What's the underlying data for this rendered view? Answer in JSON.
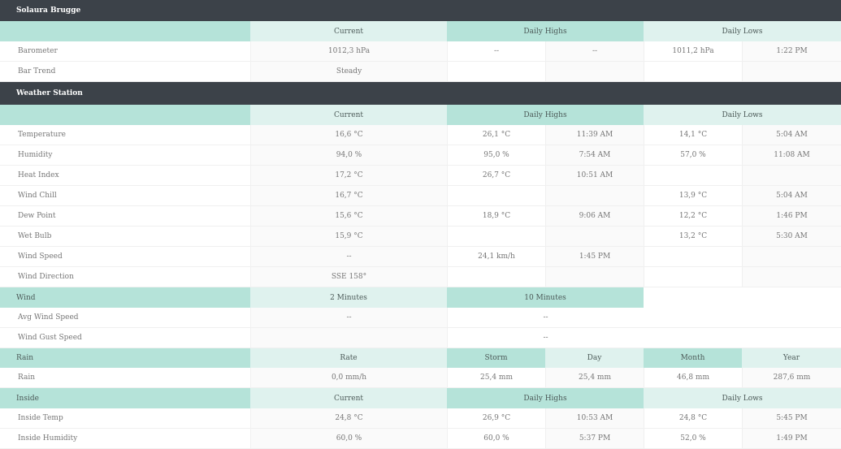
{
  "section1": {
    "title": "Solaura Brugge",
    "headers": [
      "Current",
      "Daily Highs",
      "Daily Lows"
    ],
    "rows": [
      {
        "label": "Barometer",
        "current": "1012,3 hPa",
        "high_val": "--",
        "high_time": "--",
        "low_val": "1011,2 hPa",
        "low_time": "1:22 PM"
      },
      {
        "label": "Bar Trend",
        "current": "Steady",
        "high_val": "",
        "high_time": "",
        "low_val": "",
        "low_time": ""
      }
    ]
  },
  "section2": {
    "title": "Weather Station",
    "headers": [
      "Current",
      "Daily Highs",
      "Daily Lows"
    ],
    "rows": [
      {
        "label": "Temperature",
        "current": "16,6 °C",
        "high_val": "26,1 °C",
        "high_time": "11:39 AM",
        "low_val": "14,1 °C",
        "low_time": "5:04 AM"
      },
      {
        "label": "Humidity",
        "current": "94,0 %",
        "high_val": "95,0 %",
        "high_time": "7:54 AM",
        "low_val": "57,0 %",
        "low_time": "11:08 AM"
      },
      {
        "label": "Heat Index",
        "current": "17,2 °C",
        "high_val": "26,7 °C",
        "high_time": "10:51 AM",
        "low_val": "",
        "low_time": ""
      },
      {
        "label": "Wind Chill",
        "current": "16,7 °C",
        "high_val": "",
        "high_time": "",
        "low_val": "13,9 °C",
        "low_time": "5:04 AM"
      },
      {
        "label": "Dew Point",
        "current": "15,6 °C",
        "high_val": "18,9 °C",
        "high_time": "9:06 AM",
        "low_val": "12,2 °C",
        "low_time": "1:46 PM"
      },
      {
        "label": "Wet Bulb",
        "current": "15,9 °C",
        "high_val": "",
        "high_time": "",
        "low_val": "13,2 °C",
        "low_time": "5:30 AM"
      },
      {
        "label": "Wind Speed",
        "current": "--",
        "high_val": "24,1 km/h",
        "high_time": "1:45 PM",
        "low_val": "",
        "low_time": ""
      },
      {
        "label": "Wind Direction",
        "current": "SSE 158°",
        "high_val": "",
        "high_time": "",
        "low_val": "",
        "low_time": ""
      }
    ]
  },
  "wind": {
    "label": "Wind",
    "headers": [
      "2 Minutes",
      "10 Minutes"
    ],
    "rows": [
      {
        "label": "Avg Wind Speed",
        "v2": "--",
        "v10": "--"
      },
      {
        "label": "Wind Gust Speed",
        "v2": "",
        "v10": "--"
      }
    ]
  },
  "rain": {
    "label": "Rain",
    "headers": [
      "Rate",
      "Storm",
      "Day",
      "Month",
      "Year"
    ],
    "row": {
      "label": "Rain",
      "rate": "0,0 mm/h",
      "storm": "25,4 mm",
      "day": "25,4 mm",
      "month": "46,8 mm",
      "year": "287,6 mm"
    }
  },
  "inside": {
    "label": "Inside",
    "headers": [
      "Current",
      "Daily Highs",
      "Daily Lows"
    ],
    "rows": [
      {
        "label": "Inside Temp",
        "current": "24,8 °C",
        "high_val": "26,9 °C",
        "high_time": "10:53 AM",
        "low_val": "24,8 °C",
        "low_time": "5:45 PM"
      },
      {
        "label": "Inside Humidity",
        "current": "60,0 %",
        "high_val": "60,0 %",
        "high_time": "5:37 PM",
        "low_val": "52,0 %",
        "low_time": "1:49 PM"
      }
    ]
  }
}
